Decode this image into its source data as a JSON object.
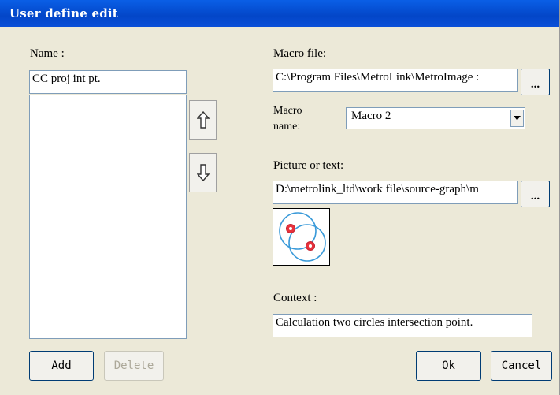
{
  "window": {
    "title": "User define edit"
  },
  "name_section": {
    "label": "Name :",
    "value": "CC proj int pt.",
    "add_label": "Add",
    "delete_label": "Delete"
  },
  "macro_file": {
    "label": "Macro file:",
    "value": "C:\\Program Files\\MetroLink\\MetroImage :",
    "browse_label": "..."
  },
  "macro_name": {
    "label_line1": "Macro",
    "label_line2": "name:",
    "selected": "Macro 2"
  },
  "picture": {
    "label": "Picture or text:",
    "value": "D:\\metrolink_ltd\\work file\\source-graph\\m",
    "browse_label": "...",
    "preview_icon": "circles-intersection-icon"
  },
  "context": {
    "label": "Context :",
    "value": "Calculation two circles intersection point."
  },
  "footer": {
    "ok_label": "Ok",
    "cancel_label": "Cancel"
  },
  "colors": {
    "title_bar": "#0346c8",
    "dialog_bg": "#ece9d8",
    "point_red": "#e8323c",
    "circle_blue": "#3a9ad9"
  }
}
